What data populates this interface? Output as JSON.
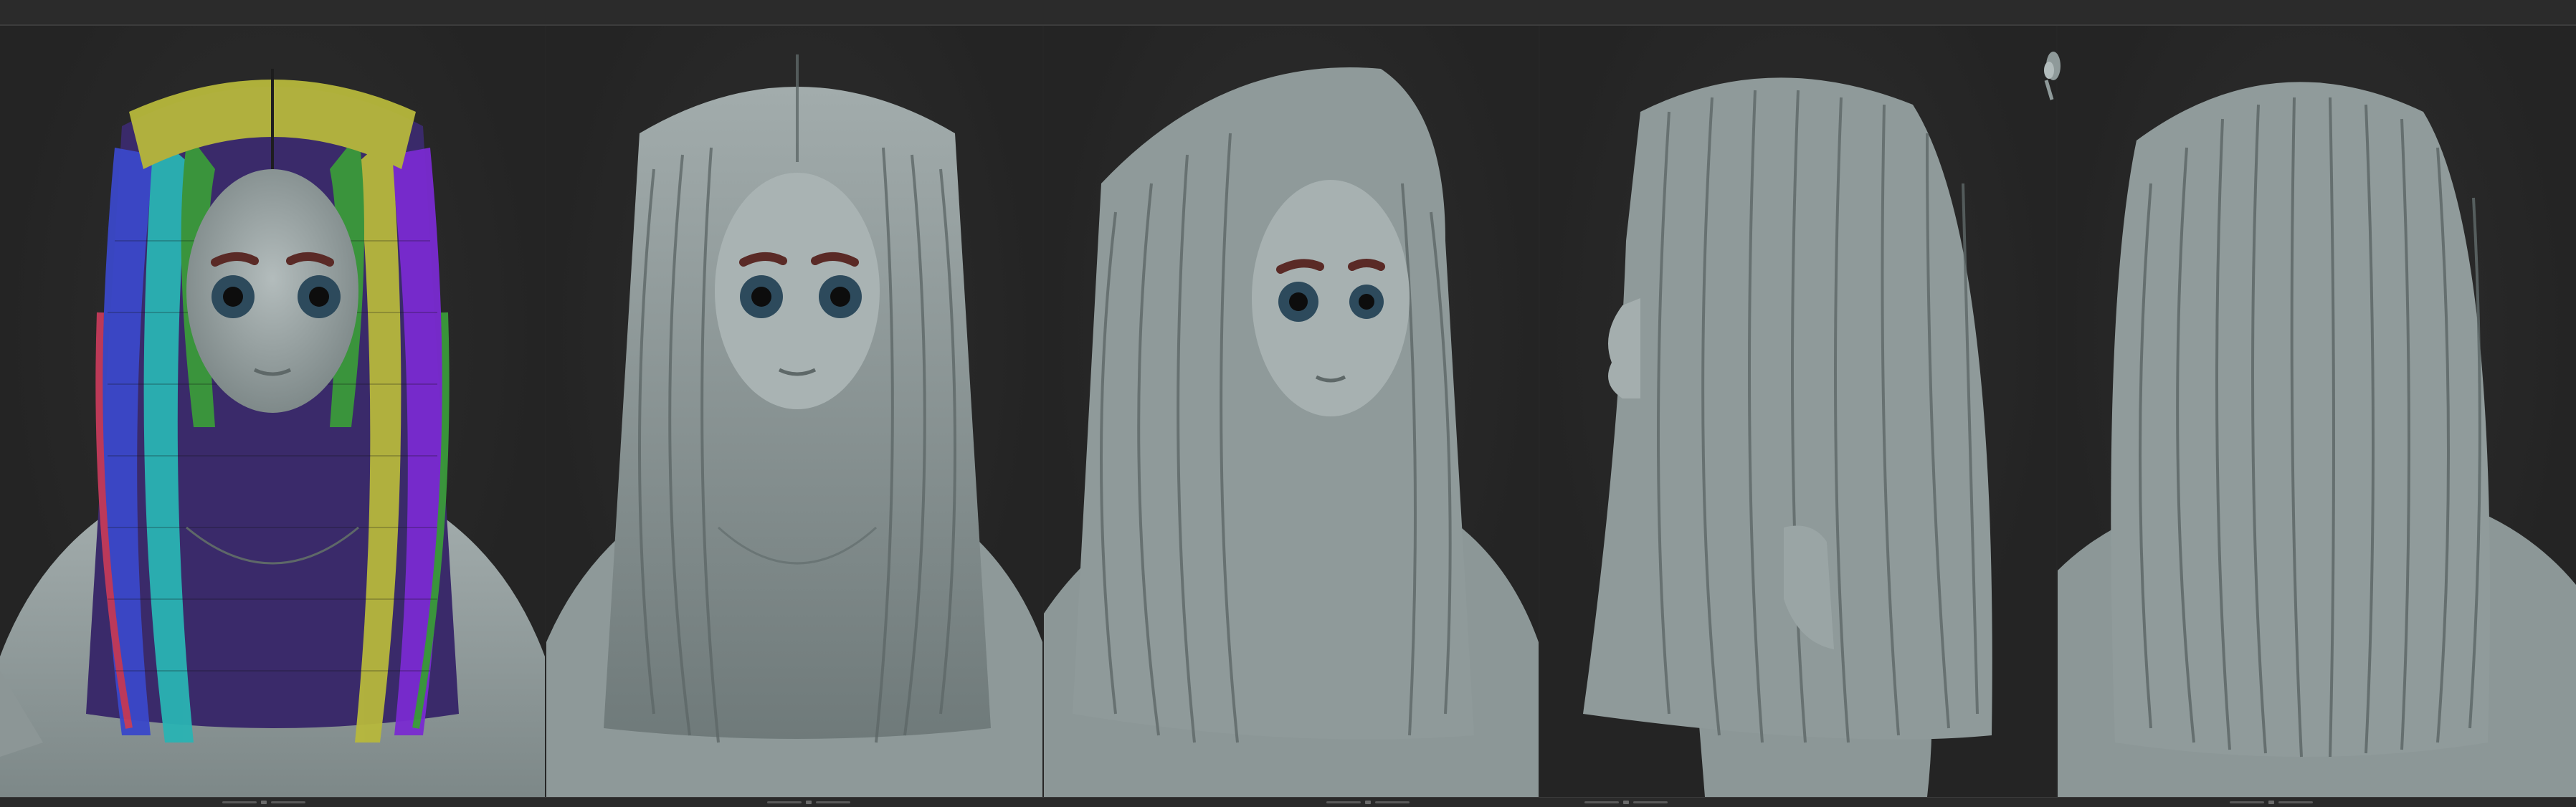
{
  "app": {
    "topbar_label": "",
    "viewports": [
      {
        "id": "front-wireframe",
        "view": "front",
        "mode": "polygroups"
      },
      {
        "id": "front-shaded",
        "view": "front",
        "mode": "shaded"
      },
      {
        "id": "three-quarter",
        "view": "three-quarter",
        "mode": "shaded"
      },
      {
        "id": "side",
        "view": "side",
        "mode": "shaded"
      },
      {
        "id": "back",
        "view": "back",
        "mode": "shaded"
      }
    ]
  },
  "colors": {
    "background": "#262626",
    "clay": "#9aa6a6",
    "clay_shadow": "#5e6868",
    "eyebrow": "#5a2a26",
    "iris": "#2d4a5c",
    "polygroup_colors": [
      "#7a2bd1",
      "#3a9a3a",
      "#b7b83c",
      "#2ab3b3",
      "#c43a5a",
      "#3a48c9"
    ]
  }
}
